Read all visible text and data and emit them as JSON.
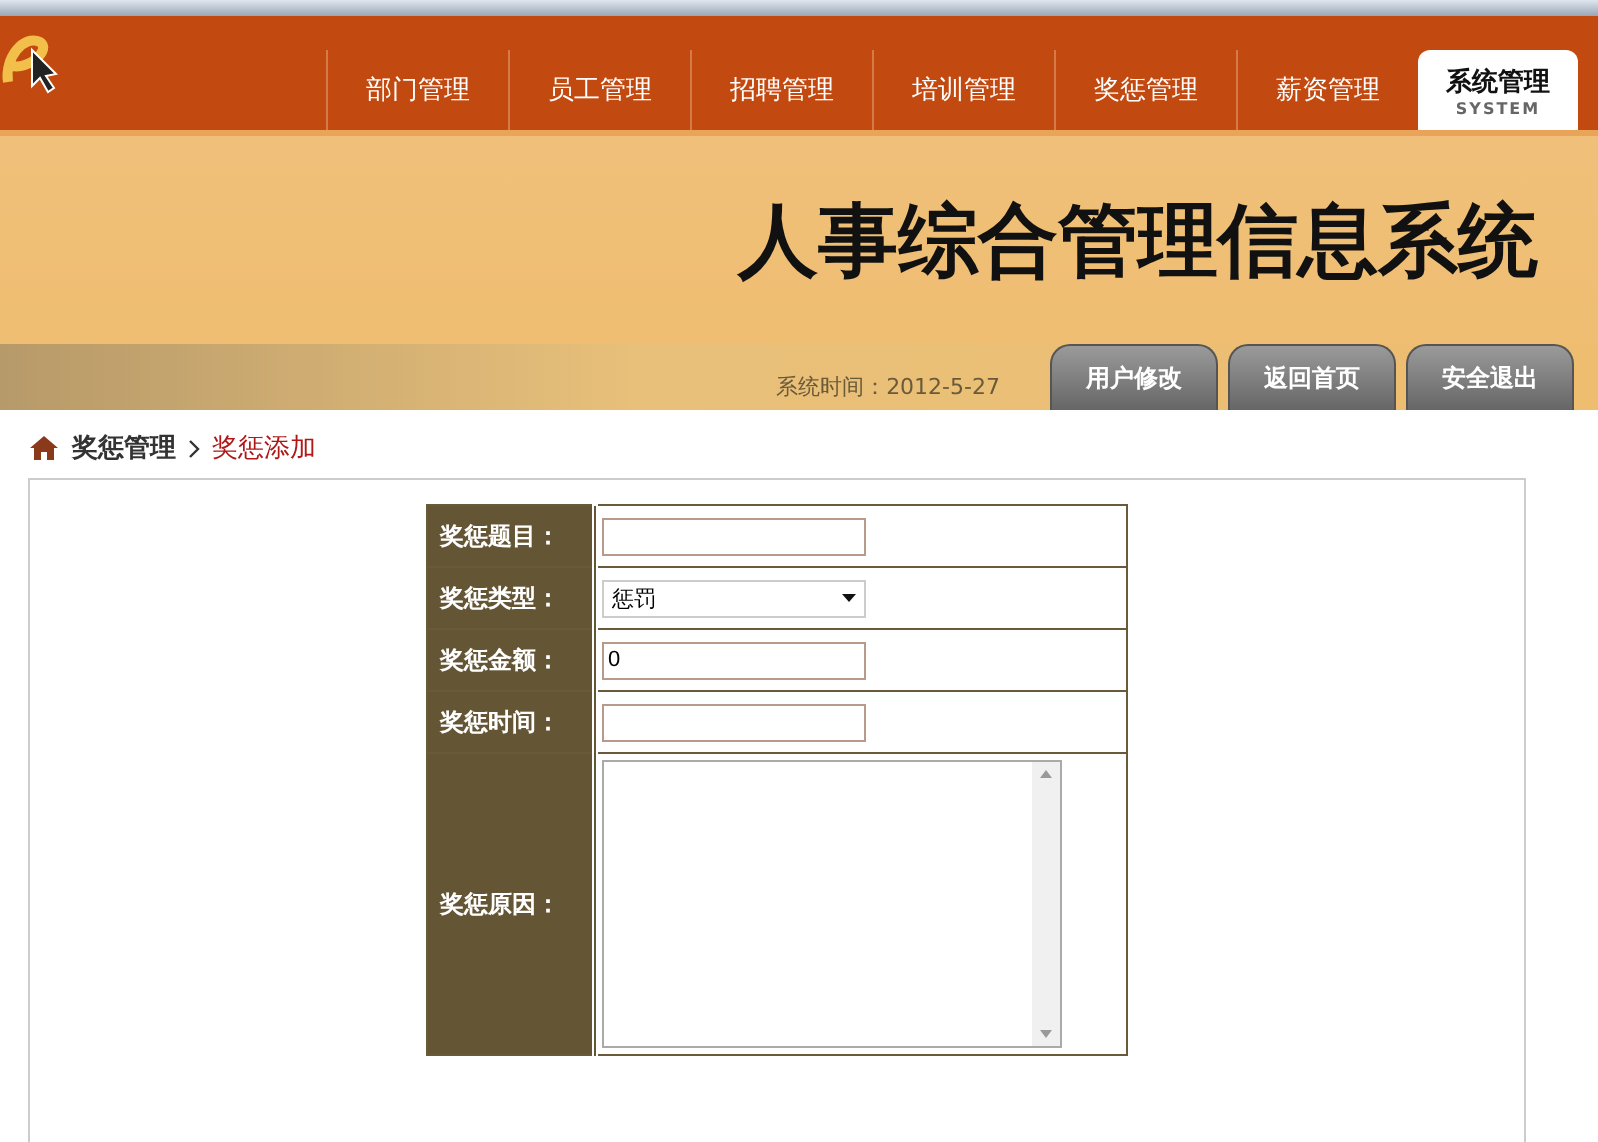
{
  "nav_tabs": [
    {
      "label": "部门管理",
      "selected": false
    },
    {
      "label": "员工管理",
      "selected": false
    },
    {
      "label": "招聘管理",
      "selected": false
    },
    {
      "label": "培训管理",
      "selected": false
    },
    {
      "label": "奖惩管理",
      "selected": false
    },
    {
      "label": "薪资管理",
      "selected": false
    },
    {
      "label": "系统管理",
      "subtitle": "SYSTEM",
      "selected": true
    }
  ],
  "banner": {
    "title": "人事综合管理信息系统",
    "system_time_label": "系统时间：",
    "system_time": "2012-5-27",
    "buttons": [
      "用户修改",
      "返回首页",
      "安全退出"
    ]
  },
  "breadcrumb": {
    "section": "奖惩管理",
    "page": "奖惩添加"
  },
  "form": [
    {
      "label": "奖惩题目：",
      "kind": "text"
    },
    {
      "label": "奖惩类型：",
      "kind": "select",
      "value": "惩罚"
    },
    {
      "label": "奖惩金额：",
      "kind": "text",
      "value": "0"
    },
    {
      "label": "奖惩时间：",
      "kind": "text"
    },
    {
      "label": "奖惩原因：",
      "kind": "textarea"
    }
  ]
}
